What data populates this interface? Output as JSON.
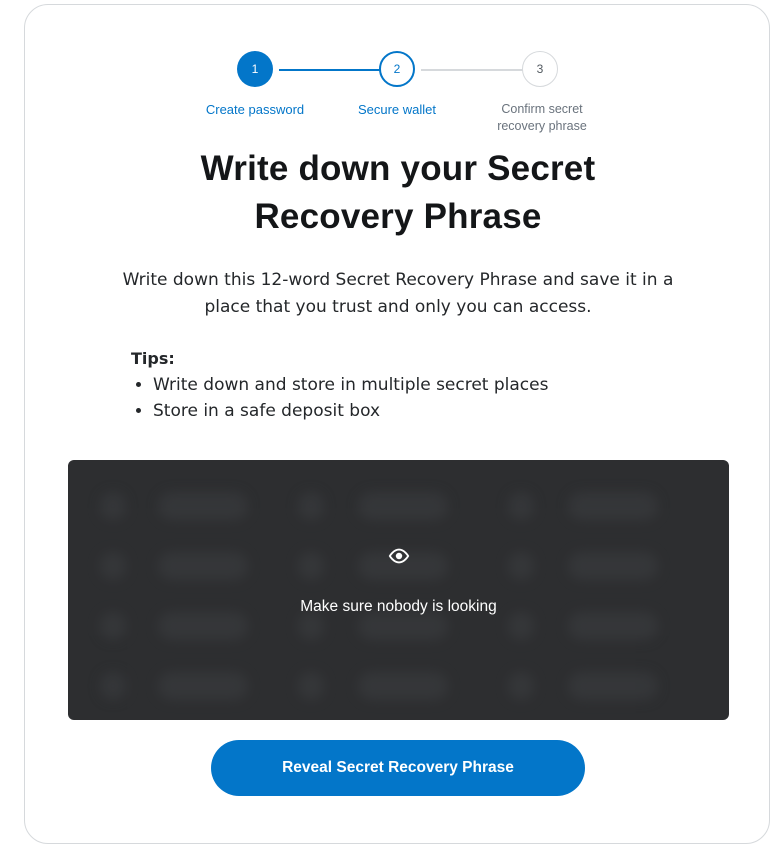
{
  "stepper": {
    "steps": [
      {
        "number": "1",
        "label": "Create password",
        "state": "complete"
      },
      {
        "number": "2",
        "label": "Secure wallet",
        "state": "active"
      },
      {
        "number": "3",
        "label": "Confirm secret recovery phrase",
        "label_line1": "Confirm secret",
        "label_line2": "recovery phrase",
        "state": "upcoming"
      }
    ]
  },
  "title": {
    "line1": "Write down your Secret",
    "line2": "Recovery Phrase"
  },
  "description": {
    "line1": "Write down this 12-word Secret Recovery Phrase and save it in a",
    "line2": "place that you trust and only you can access."
  },
  "tips": {
    "title": "Tips:",
    "items": [
      "Write down and store in multiple secret places",
      "Store in a safe deposit box"
    ]
  },
  "phrase_box": {
    "hidden": true,
    "icon": "eye-icon",
    "message": "Make sure nobody is looking"
  },
  "reveal_button": {
    "label": "Reveal Secret Recovery Phrase"
  },
  "colors": {
    "primary": "#0376c9",
    "phrase_box_bg": "#2d2e30",
    "text": "#141618",
    "muted": "#6a737d",
    "border": "#d6d9dc"
  }
}
